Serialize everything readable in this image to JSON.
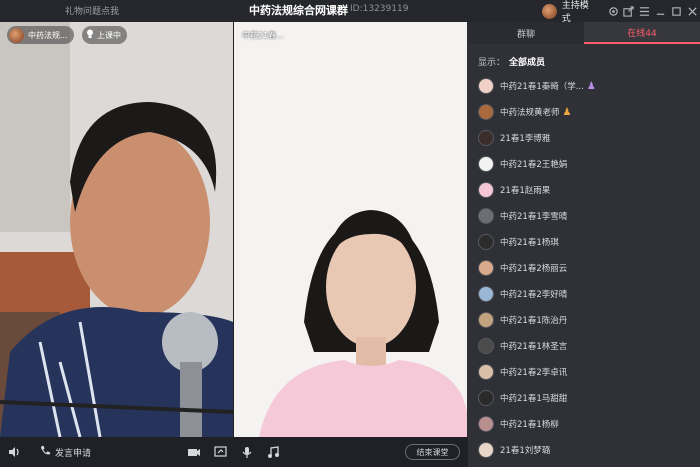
{
  "titlebar": {
    "left_link": "礼物问题点我",
    "title": "中药法规综合网课群",
    "room_id": "ID:13239119",
    "mode_label": "主持模式"
  },
  "video_a": {
    "name": "中药法规...",
    "status": "上课中"
  },
  "video_b": {
    "name": "中药21春..."
  },
  "bottombar": {
    "speak_request": "发言申请",
    "end_class": "结束课堂"
  },
  "panel": {
    "tabs": [
      "群聊",
      "在线44"
    ],
    "filter_label": "显示：",
    "filter_value": "全部成员",
    "members": [
      {
        "name": "中药21春1秦畸（学...",
        "badge": "♟",
        "badge_color": "#b98ce6",
        "avatar_color": "#f1d0c7"
      },
      {
        "name": "中药法规黄老师",
        "badge": "♟",
        "badge_color": "#f0a440",
        "avatar_color": "#a96a3e"
      },
      {
        "name": "21春1李博雅",
        "badge": "",
        "avatar_color": "#3b2d29"
      },
      {
        "name": "中药21春2王艳娟",
        "badge": "",
        "avatar_color": "#f2f2f2"
      },
      {
        "name": "21春1赵雨果",
        "badge": "",
        "avatar_color": "#f5c6d6"
      },
      {
        "name": "中药21春1李雪晴",
        "badge": "",
        "avatar_color": "#6b6e72"
      },
      {
        "name": "中药21春1杨琪",
        "badge": "",
        "avatar_color": "#2c2c2c"
      },
      {
        "name": "中药21春2杨丽云",
        "badge": "",
        "avatar_color": "#d9a98b"
      },
      {
        "name": "中药21春2李好晴",
        "badge": "",
        "avatar_color": "#9ab7d6"
      },
      {
        "name": "中药21春1陈治丹",
        "badge": "",
        "avatar_color": "#c2a37e"
      },
      {
        "name": "中药21春1林圣言",
        "badge": "",
        "avatar_color": "#4b4b4b"
      },
      {
        "name": "中药21春2李卓讯",
        "badge": "",
        "avatar_color": "#d8c0a8"
      },
      {
        "name": "中药21春1马甜甜",
        "badge": "",
        "avatar_color": "#2a2a2a"
      },
      {
        "name": "中药21春1杨柳",
        "badge": "",
        "avatar_color": "#b88e8e"
      },
      {
        "name": "21春1刘梦璐",
        "badge": "",
        "avatar_color": "#e8d6c9"
      }
    ]
  },
  "icons": [
    "settings-icon",
    "share-icon",
    "menu-icon",
    "minimize-icon",
    "maximize-icon",
    "close-icon",
    "volume-icon",
    "phone-icon",
    "camera-icon",
    "screen-share-icon",
    "mic-icon",
    "music-icon"
  ]
}
